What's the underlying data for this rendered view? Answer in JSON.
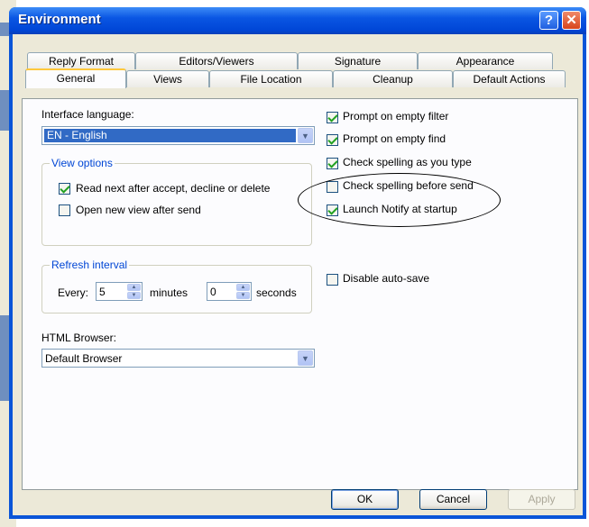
{
  "window": {
    "title": "Environment",
    "help_label": "?",
    "close_label": "✕"
  },
  "tabs_row1": [
    "Reply Format",
    "Editors/Viewers",
    "Signature",
    "Appearance"
  ],
  "tabs_row2": [
    "General",
    "Views",
    "File Location",
    "Cleanup",
    "Default Actions"
  ],
  "active_tab": "General",
  "interface_language": {
    "label": "Interface language:",
    "value": "EN - English"
  },
  "view_options": {
    "legend": "View options",
    "read_next": {
      "label": "Read next after accept, decline or delete",
      "checked": true
    },
    "open_new_view": {
      "label": "Open new view after send",
      "checked": false
    }
  },
  "refresh_interval": {
    "legend": "Refresh interval",
    "every_label": "Every:",
    "minutes_value": "5",
    "minutes_label": "minutes",
    "seconds_value": "0",
    "seconds_label": "seconds"
  },
  "html_browser": {
    "label": "HTML Browser:",
    "value": "Default Browser"
  },
  "options": [
    {
      "label": "Prompt on empty filter",
      "checked": true
    },
    {
      "label": "Prompt on empty find",
      "checked": true
    },
    {
      "label": "Check spelling as you type",
      "checked": true
    },
    {
      "label": "Check spelling before send",
      "checked": false
    },
    {
      "label": "Launch Notify at startup",
      "checked": true
    }
  ],
  "disable_autosave": {
    "label": "Disable auto-save",
    "checked": false
  },
  "buttons": {
    "ok": "OK",
    "cancel": "Cancel",
    "apply": "Apply"
  },
  "colors": {
    "title_bar": "#0a56e3",
    "dialog_bg": "#ece9d8",
    "tab_highlight": "#ffc83c",
    "selection": "#316ac5"
  }
}
